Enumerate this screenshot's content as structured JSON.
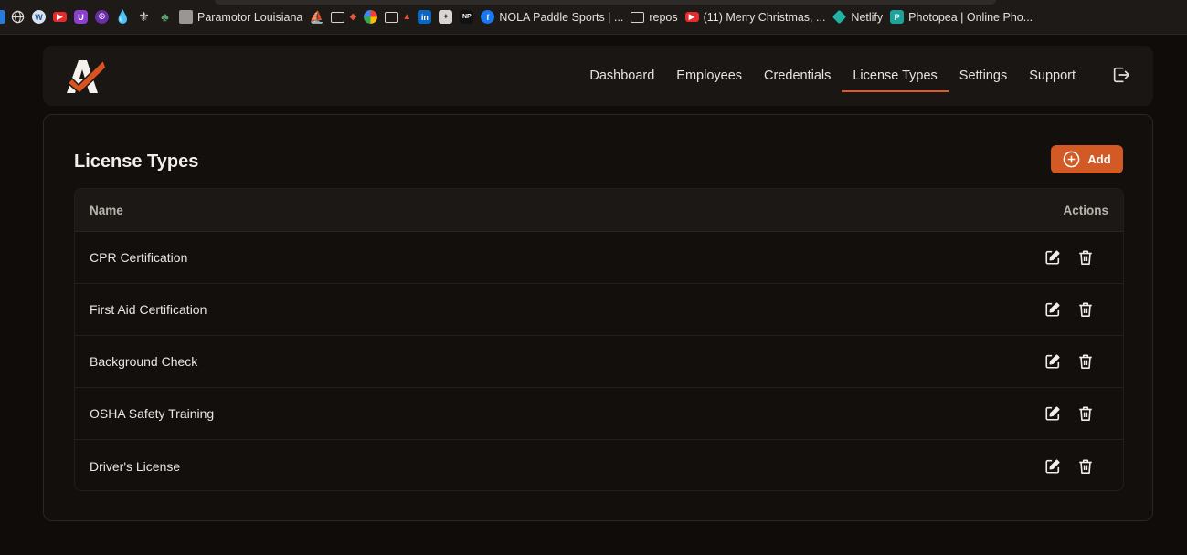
{
  "bookmarks": [
    {
      "label": "Paramotor Louisiana"
    },
    {
      "label": "NOLA Paddle Sports | ..."
    },
    {
      "label": "repos"
    },
    {
      "label": "(11) Merry Christmas, ..."
    },
    {
      "label": "Netlify"
    },
    {
      "label": "Photopea | Online Pho..."
    }
  ],
  "nav": {
    "items": [
      "Dashboard",
      "Employees",
      "Credentials",
      "License Types",
      "Settings",
      "Support"
    ],
    "active": "License Types"
  },
  "page": {
    "title": "License Types",
    "add_label": "Add"
  },
  "table": {
    "columns": [
      "Name",
      "Actions"
    ],
    "rows": [
      {
        "name": "CPR Certification"
      },
      {
        "name": "First Aid Certification"
      },
      {
        "name": "Background Check"
      },
      {
        "name": "OSHA Safety Training"
      },
      {
        "name": "Driver's License"
      }
    ]
  },
  "colors": {
    "accent": "#d35a24",
    "background": "#0f0c0a",
    "card": "#130f0d"
  }
}
